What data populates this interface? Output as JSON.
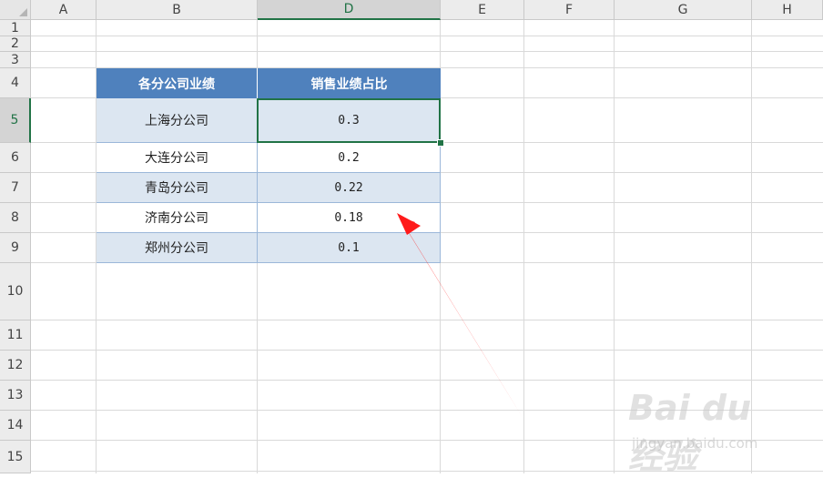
{
  "columns": [
    "A",
    "B",
    "D",
    "E",
    "F",
    "G",
    "H"
  ],
  "rows": [
    "1",
    "2",
    "3",
    "4",
    "5",
    "6",
    "7",
    "8",
    "9",
    "10",
    "11",
    "12",
    "13",
    "14",
    "15"
  ],
  "selected_column": "D",
  "selected_row": "5",
  "table": {
    "header": [
      "各分公司业绩",
      "销售业绩占比"
    ],
    "rows": [
      [
        "上海分公司",
        "0.3"
      ],
      [
        "大连分公司",
        "0.2"
      ],
      [
        "青岛分公司",
        "0.22"
      ],
      [
        "济南分公司",
        "0.18"
      ],
      [
        "郑州分公司",
        "0.1"
      ]
    ]
  },
  "colors": {
    "header_fill": "#4f81bd",
    "band_fill": "#dce6f1",
    "selection": "#217346",
    "arrow": "#ff1a1a"
  },
  "watermark": {
    "logo_text": "Bai du 经验",
    "site": "jingyan.baidu.com"
  }
}
